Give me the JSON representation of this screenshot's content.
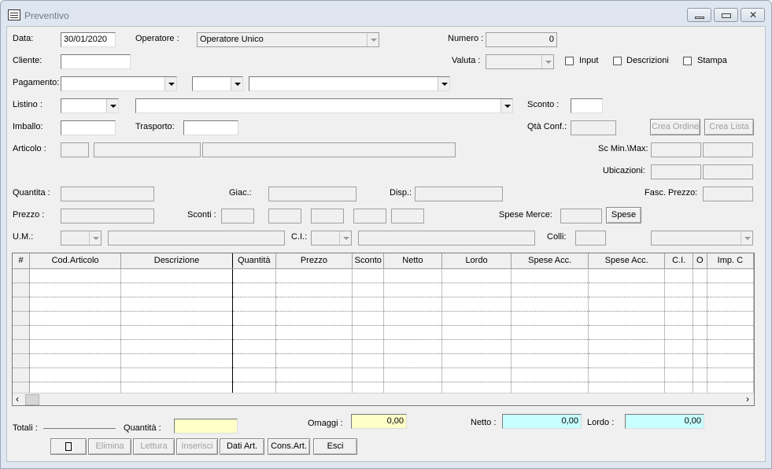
{
  "window": {
    "title": "Preventivo"
  },
  "header": {
    "data_label": "Data:",
    "data_value": "30/01/2020",
    "operatore_label": "Operatore :",
    "operatore_value": "Operatore Unico",
    "numero_label": "Numero :",
    "numero_value": "0",
    "cliente_label": "Cliente:",
    "valuta_label": "Valuta :",
    "input_label": "Input",
    "descrizioni_label": "Descrizioni",
    "stampa_label": "Stampa",
    "pagamento_label": "Pagamento:",
    "listino_label": "Listino :",
    "sconto_label": "Sconto :",
    "imballo_label": "Imballo:",
    "trasporto_label": "Trasporto:",
    "qta_conf_label": "Qtà Conf.:",
    "crea_ordine_label": "Crea Ordine",
    "crea_ordine_key": "O",
    "crea_lista_label": "Crea Lista",
    "articolo_label": "Articolo :",
    "sc_minmax_label": "Sc Min.\\Max:",
    "ubicazioni_label": "Ubicazioni:",
    "quantita_label": "Quantita :",
    "giac_label": "Giac.:",
    "disp_label": "Disp.:",
    "fasc_prezzo_label": "Fasc. Prezzo:",
    "prezzo_label": "Prezzo :",
    "sconti_label": "Sconti :",
    "spese_merce_label": "Spese Merce:",
    "spese_button": "Spese",
    "um_label": "U.M.:",
    "ci_label": "C.I.:",
    "colli_label": "Colli:"
  },
  "grid": {
    "columns": [
      "#",
      "Cod.Articolo",
      "Descrizione",
      "Quantità",
      "Prezzo",
      "Sconto",
      "Netto",
      "Lordo",
      "Spese Acc.",
      "Spese Acc.",
      "C.I.",
      "O",
      "Imp. C"
    ],
    "empty_rows": 9
  },
  "footer": {
    "totali_label": "Totali :",
    "quantita_label": "Quantità :",
    "omaggi_label": "Omaggi :",
    "omaggi_value": "0,00",
    "netto_label": "Netto :",
    "netto_value": "0,00",
    "lordo_label": "Lordo :",
    "lordo_value": "0,00"
  },
  "buttons": {
    "elimina": "Elimina",
    "lettura": "Lettura",
    "inserisci": "Inserisci",
    "dati_art": "Dati Art.",
    "cons_art": "Cons.Art.",
    "esci": "Esci"
  }
}
